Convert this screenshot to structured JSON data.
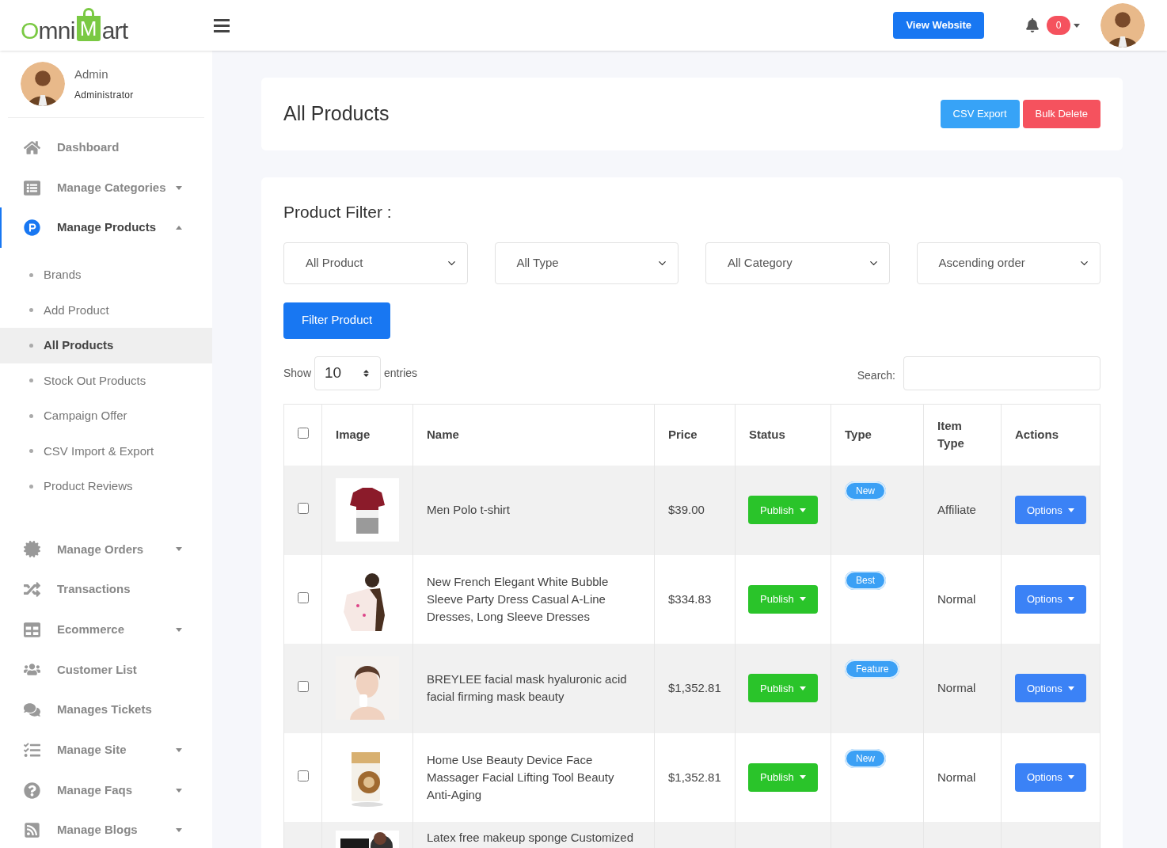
{
  "logo": [
    "O",
    "mni",
    "M",
    "art"
  ],
  "header": {
    "view_website": "View Website",
    "notification_count": "0"
  },
  "user": {
    "name": "Admin",
    "role": "Administrator"
  },
  "sidebar": {
    "items": [
      {
        "label": "Dashboard",
        "dropdown": false,
        "selected": false
      },
      {
        "label": "Manage Categories",
        "dropdown": true,
        "expanded": false,
        "selected": false
      },
      {
        "label": "Manage Products",
        "dropdown": true,
        "expanded": true,
        "selected": true,
        "children": [
          {
            "label": "Brands",
            "selected": false
          },
          {
            "label": "Add Product",
            "selected": false
          },
          {
            "label": "All Products",
            "selected": true
          },
          {
            "label": "Stock Out Products",
            "selected": false
          },
          {
            "label": "Campaign Offer",
            "selected": false
          },
          {
            "label": "CSV Import & Export",
            "selected": false
          },
          {
            "label": "Product Reviews",
            "selected": false
          }
        ]
      },
      {
        "label": "Manage Orders",
        "dropdown": true,
        "expanded": false,
        "selected": false
      },
      {
        "label": "Transactions",
        "dropdown": false,
        "selected": false
      },
      {
        "label": "Ecommerce",
        "dropdown": true,
        "expanded": false,
        "selected": false
      },
      {
        "label": "Customer List",
        "dropdown": false,
        "selected": false
      },
      {
        "label": "Manages Tickets",
        "dropdown": false,
        "selected": false
      },
      {
        "label": "Manage Site",
        "dropdown": true,
        "expanded": false,
        "selected": false
      },
      {
        "label": "Manage Faqs",
        "dropdown": true,
        "expanded": false,
        "selected": false
      },
      {
        "label": "Manage Blogs",
        "dropdown": true,
        "expanded": false,
        "selected": false
      }
    ]
  },
  "page": {
    "title": "All Products",
    "buttons": [
      "CSV Export",
      "Bulk Delete"
    ]
  },
  "filter": {
    "title": "Product Filter :",
    "selects": [
      "All Product",
      "All Type",
      "All Category",
      "Ascending order"
    ],
    "button": "Filter Product"
  },
  "table_controls": {
    "show_label": "Show",
    "page_size": "10",
    "entries_label": "entries",
    "search_label": "Search:"
  },
  "table": {
    "select_all": {
      "checked": false
    },
    "columns": [
      "Image",
      "Name",
      "Price",
      "Status",
      "Type",
      "Item Type",
      "Actions"
    ],
    "rows": [
      {
        "checked": false,
        "name": "Men Polo t-shirt",
        "price": "$39.00",
        "status": "Publish",
        "type": "New",
        "item_type": "Affiliate",
        "action": "Options"
      },
      {
        "checked": false,
        "name": "New French Elegant White Bubble Sleeve Party Dress Casual A-Line Dresses, Long Sleeve Dresses",
        "price": "$334.83",
        "status": "Publish",
        "type": "Best",
        "item_type": "Normal",
        "action": "Options"
      },
      {
        "checked": false,
        "name": "BREYLEE facial mask hyaluronic acid facial firming mask beauty",
        "price": "$1,352.81",
        "status": "Publish",
        "type": "Feature",
        "item_type": "Normal",
        "action": "Options"
      },
      {
        "checked": false,
        "name": "Home Use Beauty Device Face Massager Facial Lifting Tool Beauty Anti-Aging",
        "price": "$1,352.81",
        "status": "Publish",
        "type": "New",
        "item_type": "Normal",
        "action": "Options"
      },
      {
        "name": "Latex free makeup sponge Customized"
      }
    ]
  }
}
